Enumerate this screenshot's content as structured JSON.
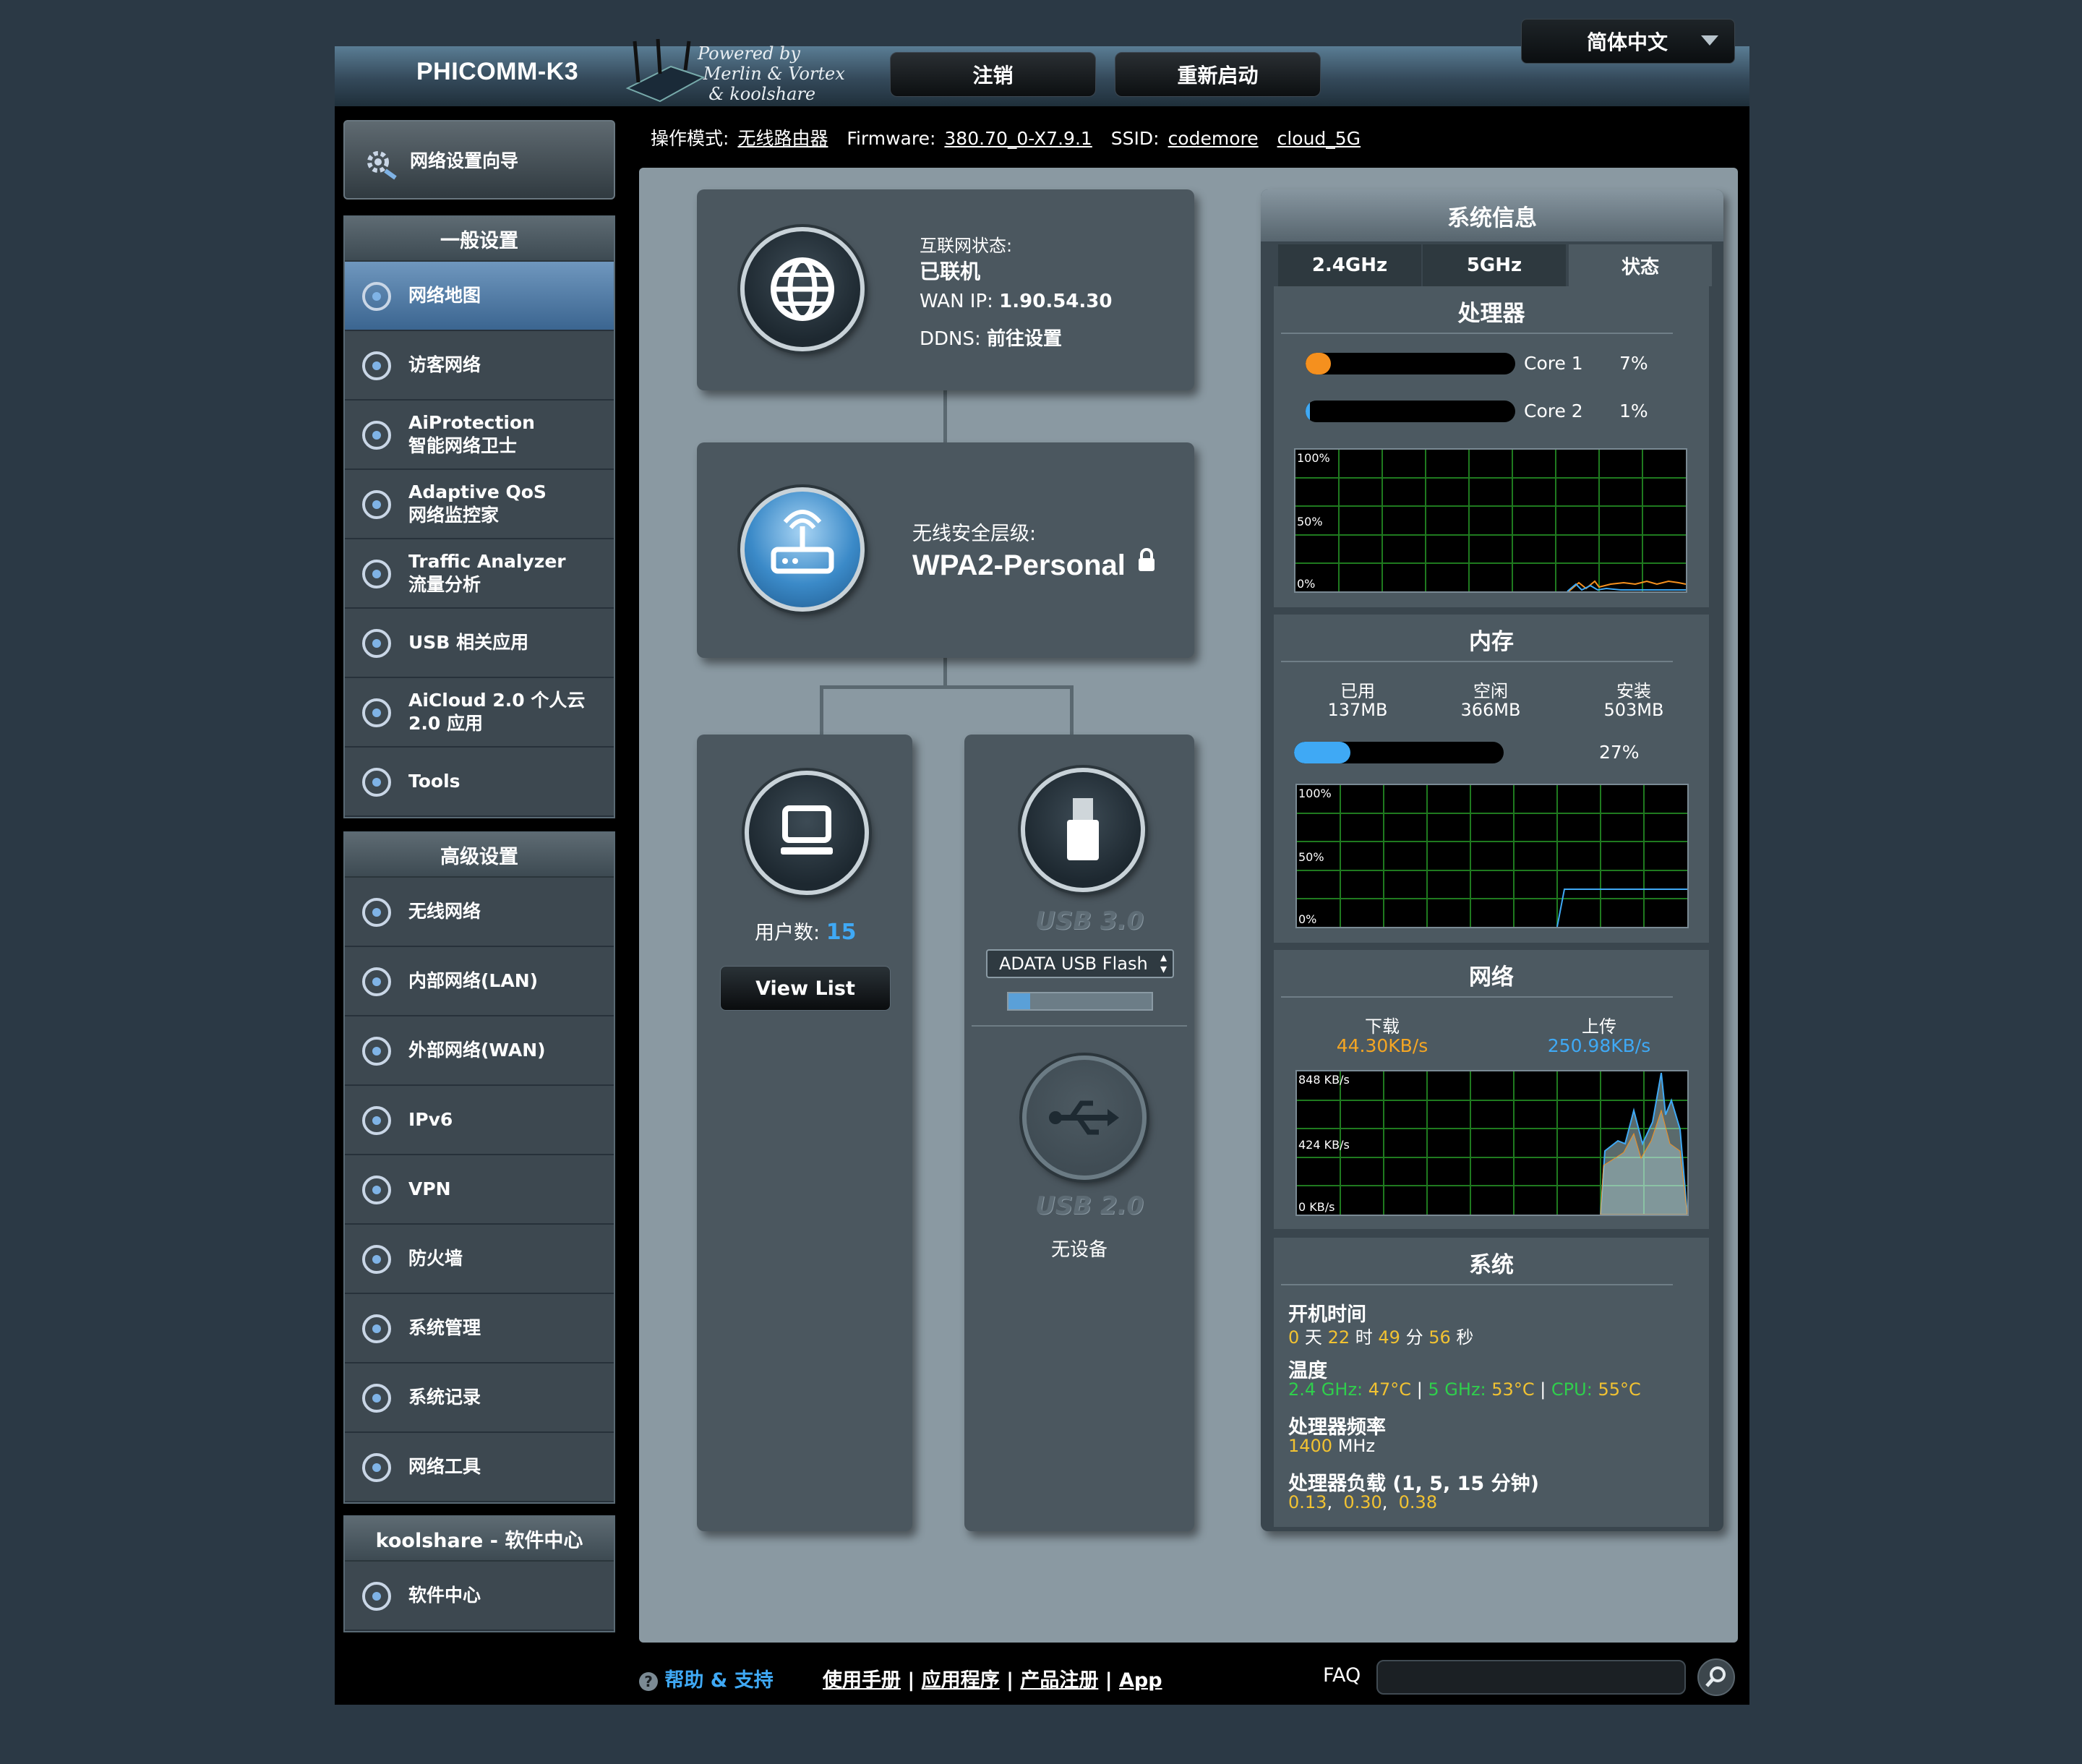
{
  "header": {
    "brand": "PHICOMM-K3",
    "powered_by": "Powered by\n Merlin & Vortex\n  & koolshare",
    "logout": "注销",
    "reboot": "重新启动",
    "language": "简体中文"
  },
  "status_bar": {
    "mode_label": "操作模式:",
    "mode_value": "无线路由器",
    "firmware_label": "Firmware:",
    "firmware_value": "380.70_0-X7.9.1",
    "ssid_label": "SSID:",
    "ssid_1": "codemore",
    "ssid_2": "cloud_5G",
    "icons": [
      "globe-icon",
      "wifi-icon",
      "users-icon",
      "monitor-icon",
      "usb-icon"
    ]
  },
  "sidebar": {
    "wizard": "网络设置向导",
    "general_title": "一般设置",
    "general_items": [
      {
        "label": "网络地图",
        "icon": "network-map-icon"
      },
      {
        "label": "访客网络",
        "icon": "guest-network-icon"
      },
      {
        "label": "AiProtection\n智能网络卫士",
        "icon": "shield-icon"
      },
      {
        "label": "Adaptive QoS\n网络监控家",
        "icon": "gauge-icon"
      },
      {
        "label": "Traffic Analyzer\n流量分析",
        "icon": "pulse-icon"
      },
      {
        "label": "USB 相关应用",
        "icon": "usb-app-icon"
      },
      {
        "label": "AiCloud 2.0 个人云\n2.0 应用",
        "icon": "cloud-icon"
      },
      {
        "label": "Tools",
        "icon": "wrench-icon"
      }
    ],
    "advanced_title": "高级设置",
    "advanced_items": [
      {
        "label": "无线网络",
        "icon": "wireless-icon"
      },
      {
        "label": "内部网络(LAN)",
        "icon": "lan-icon"
      },
      {
        "label": "外部网络(WAN)",
        "icon": "wan-icon"
      },
      {
        "label": "IPv6",
        "icon": "ipv6-icon"
      },
      {
        "label": "VPN",
        "icon": "vpn-icon"
      },
      {
        "label": "防火墙",
        "icon": "firewall-icon"
      },
      {
        "label": "系统管理",
        "icon": "admin-gear-icon"
      },
      {
        "label": "系统记录",
        "icon": "log-icon"
      },
      {
        "label": "网络工具",
        "icon": "net-tools-icon"
      }
    ],
    "koolshare_title": "koolshare - 软件中心",
    "koolshare_items": [
      {
        "label": "软件中心",
        "icon": "software-center-icon"
      }
    ]
  },
  "internet": {
    "status_label": "互联网状态:",
    "status_value": "已联机",
    "wan_ip_label": "WAN IP:",
    "wan_ip_value": "1.90.54.30",
    "ddns_label": "DDNS:",
    "ddns_value": "前往设置"
  },
  "wireless": {
    "security_label": "无线安全层级:",
    "security_value": "WPA2-Personal"
  },
  "clients": {
    "label": "用户数:",
    "count": "15",
    "view_list": "View List"
  },
  "usb": {
    "usb3_label": "USB 3.0",
    "usb3_device": "ADATA USB Flash",
    "usb3_usage_fraction": 0.15,
    "usb2_label": "USB 2.0",
    "usb2_status": "无设备"
  },
  "sysinfo": {
    "title": "系统信息",
    "tabs": [
      "2.4GHz",
      "5GHz",
      "状态"
    ],
    "active_tab": "状态",
    "cpu": {
      "title": "处理器",
      "cores": [
        {
          "name": "Core 1",
          "percent": "7%",
          "value": 7,
          "color": "#f5901e"
        },
        {
          "name": "Core 2",
          "percent": "1%",
          "value": 1,
          "color": "#3fa9f5"
        }
      ],
      "graph_labels": [
        "100%",
        "50%",
        "0%"
      ]
    },
    "memory": {
      "title": "内存",
      "used_label": "已用",
      "used_value": "137MB",
      "free_label": "空闲",
      "free_value": "366MB",
      "total_label": "安装",
      "total_value": "503MB",
      "percent": "27%",
      "percent_value": 27,
      "graph_labels": [
        "100%",
        "50%",
        "0%"
      ]
    },
    "network": {
      "title": "网络",
      "down_label": "下载",
      "down_value": "44.30KB/s",
      "up_label": "上传",
      "up_value": "250.98KB/s",
      "graph_labels": [
        "848 KB/s",
        "424 KB/s",
        "0 KB/s"
      ]
    },
    "system": {
      "title": "系统",
      "uptime_label": "开机时间",
      "uptime_d": "0",
      "uptime_d_unit": "天",
      "uptime_h": "22",
      "uptime_h_unit": "时",
      "uptime_m": "49",
      "uptime_m_unit": "分",
      "uptime_s": "56",
      "uptime_s_unit": "秒",
      "temp_label": "温度",
      "temp_24_label": "2.4 GHz:",
      "temp_24": "47°C",
      "temp_5_label": "5 GHz:",
      "temp_5": "53°C",
      "temp_cpu_label": "CPU:",
      "temp_cpu": "55°C",
      "freq_label": "处理器频率",
      "freq_value": "1400",
      "freq_unit": "MHz",
      "load_label": "处理器负载 (1, 5, 15 分钟)",
      "load_1": "0.13",
      "load_5": "0.30",
      "load_15": "0.38"
    }
  },
  "footer": {
    "help": "帮助 & 支持",
    "manual": "使用手册",
    "apps": "应用程序",
    "register": "产品注册",
    "app": "App",
    "faq": "FAQ"
  }
}
